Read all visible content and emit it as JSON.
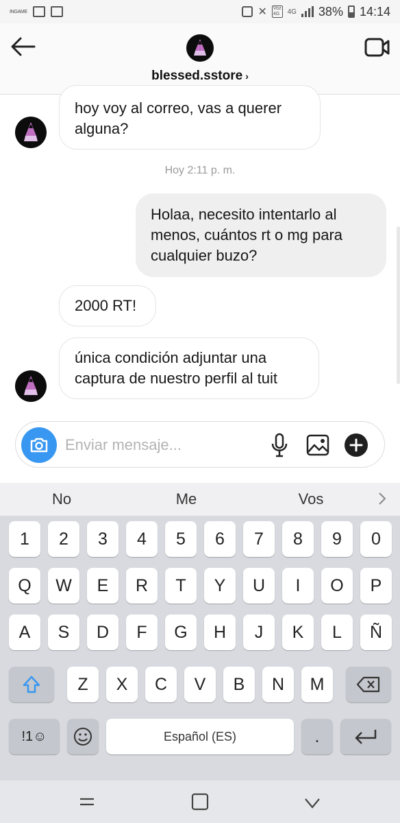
{
  "status_bar": {
    "left_label": "INGAME",
    "volte": "Voz\n4G",
    "network": "4G",
    "battery": "38%",
    "time": "14:14"
  },
  "header": {
    "username": "blessed.sstore",
    "chevron": "›"
  },
  "messages": [
    {
      "id": "m1",
      "direction": "in",
      "text": "hoy voy al correo, vas a querer alguna?"
    },
    {
      "id": "ts1",
      "type": "timestamp",
      "text": "Hoy 2:11 p. m."
    },
    {
      "id": "m2",
      "direction": "out",
      "text": "Holaa, necesito intentarlo al menos, cuántos rt o mg para cualquier buzo?"
    },
    {
      "id": "m3",
      "direction": "in",
      "text": "2000 RT!"
    },
    {
      "id": "m4",
      "direction": "in",
      "text": "única condición adjuntar una captura de nuestro perfil al tuit"
    }
  ],
  "composer": {
    "placeholder": "Enviar mensaje...",
    "value": ""
  },
  "keyboard": {
    "suggestions": [
      "No",
      "Me",
      "Vos"
    ],
    "row_numbers": [
      "1",
      "2",
      "3",
      "4",
      "5",
      "6",
      "7",
      "8",
      "9",
      "0"
    ],
    "row_1": [
      "Q",
      "W",
      "E",
      "R",
      "T",
      "Y",
      "U",
      "I",
      "O",
      "P"
    ],
    "row_2": [
      "A",
      "S",
      "D",
      "F",
      "G",
      "H",
      "J",
      "K",
      "L",
      "Ñ"
    ],
    "row_3": [
      "Z",
      "X",
      "C",
      "V",
      "B",
      "N",
      "M"
    ],
    "symbols_label": "!1☺",
    "space_label": "Español (ES)",
    "period_label": "."
  },
  "colors": {
    "accent": "#3897f0",
    "incoming_bubble": "#ffffff",
    "outgoing_bubble": "#efefef",
    "keyboard_bg": "#d8dadf"
  }
}
